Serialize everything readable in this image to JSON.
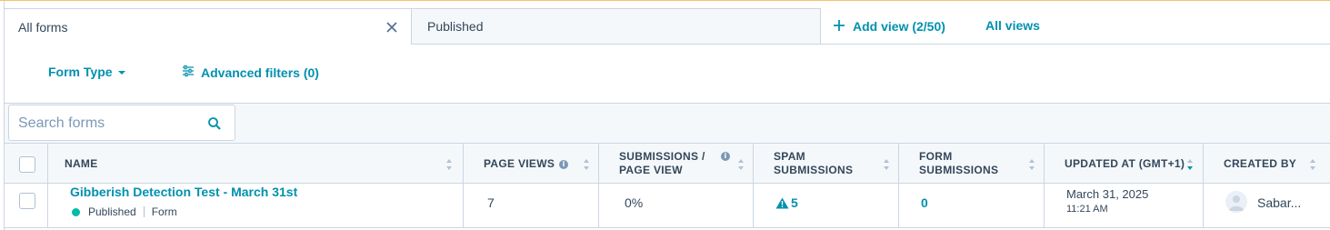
{
  "tabs": [
    {
      "label": "All forms"
    },
    {
      "label": "Published"
    }
  ],
  "view_actions": {
    "add_view": "Add view (2/50)",
    "all_views": "All views"
  },
  "filters": {
    "form_type": "Form Type",
    "advanced": "Advanced filters (0)"
  },
  "search": {
    "placeholder": "Search forms"
  },
  "table": {
    "columns": [
      {
        "label": "NAME"
      },
      {
        "label": "PAGE VIEWS"
      },
      {
        "label": "SUBMISSIONS / PAGE VIEW"
      },
      {
        "label": "SPAM SUBMISSIONS"
      },
      {
        "label": "FORM SUBMISSIONS"
      },
      {
        "label": "UPDATED AT (GMT+1)"
      },
      {
        "label": "CREATED BY"
      }
    ],
    "rows": [
      {
        "name": "Gibberish Detection Test - March 31st",
        "status": "Published",
        "type": "Form",
        "page_views": "7",
        "submission_rate": "0%",
        "spam_submissions": "5",
        "form_submissions": "0",
        "updated_date": "March 31, 2025",
        "updated_time": "11:21 AM",
        "created_by": "Sabar..."
      }
    ]
  },
  "colors": {
    "accent": "#0091ae",
    "published": "#00bda5",
    "border": "#cbd6e2",
    "text": "#33475b"
  },
  "icons": [
    "close-icon",
    "plus-icon",
    "caret-down-icon",
    "sliders-icon",
    "search-icon",
    "sort-icon",
    "info-icon",
    "warning-icon",
    "avatar-icon"
  ]
}
